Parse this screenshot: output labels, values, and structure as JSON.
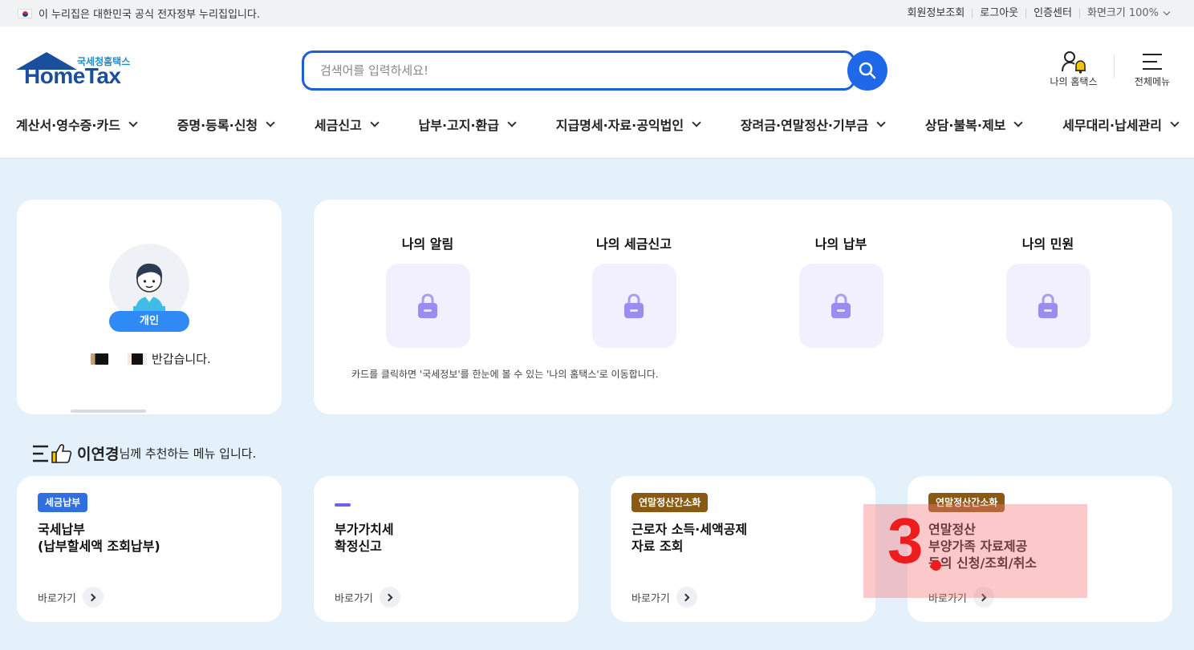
{
  "topbar": {
    "gov_notice": "이 누리집은 대한민국 공식 전자정부 누리집입니다.",
    "links": [
      "회원정보조회",
      "로그아웃",
      "인증센터",
      "화면크기"
    ],
    "zoom_value": "100%"
  },
  "header": {
    "logo_sub": "국세청홈택스",
    "logo_main": "HomeTax",
    "search_placeholder": "검색어를 입력하세요!",
    "my_hometax_label": "나의 홈택스",
    "all_menu_label": "전체메뉴"
  },
  "nav": {
    "items": [
      "계산서·영수증·카드",
      "증명·등록·신청",
      "세금신고",
      "납부·고지·환급",
      "지급명세·자료·공익법인",
      "장려금·연말정산·기부금",
      "상담·불복·제보",
      "세무대리·납세관리"
    ]
  },
  "profile": {
    "type_badge": "개인",
    "greeting": "반갑습니다."
  },
  "my_cards": {
    "tiles": [
      "나의 알림",
      "나의 세금신고",
      "나의 납부",
      "나의 민원"
    ],
    "note": "카드를 클릭하면 '국세정보'를 한눈에 볼 수 있는 '나의 홈택스'로 이동합니다."
  },
  "recommend": {
    "user_name": "이연경",
    "suffix": "님께 추천하는 메뉴 입니다.",
    "cards": [
      {
        "tag": "세금납부",
        "title": "국세납부\n(납부할세액 조회납부)",
        "link": "바로가기"
      },
      {
        "tag": "",
        "title": "부가가치세\n확정신고",
        "link": "바로가기"
      },
      {
        "tag": "연말정산간소화",
        "title": "근로자 소득·세액공제\n자료 조회",
        "link": "바로가기"
      },
      {
        "tag": "연말정산간소화",
        "title": "연말정산\n부양가족 자료제공\n동의 신청/조회/취소",
        "link": "바로가기"
      }
    ]
  },
  "annotation": {
    "number": "3"
  },
  "colors": {
    "primary": "#1f68e8",
    "page_bg": "#e4f0fa",
    "brand": "#1a4f9e",
    "tag_brown": "#8a5a12",
    "marker_red": "#ee1c1c"
  }
}
